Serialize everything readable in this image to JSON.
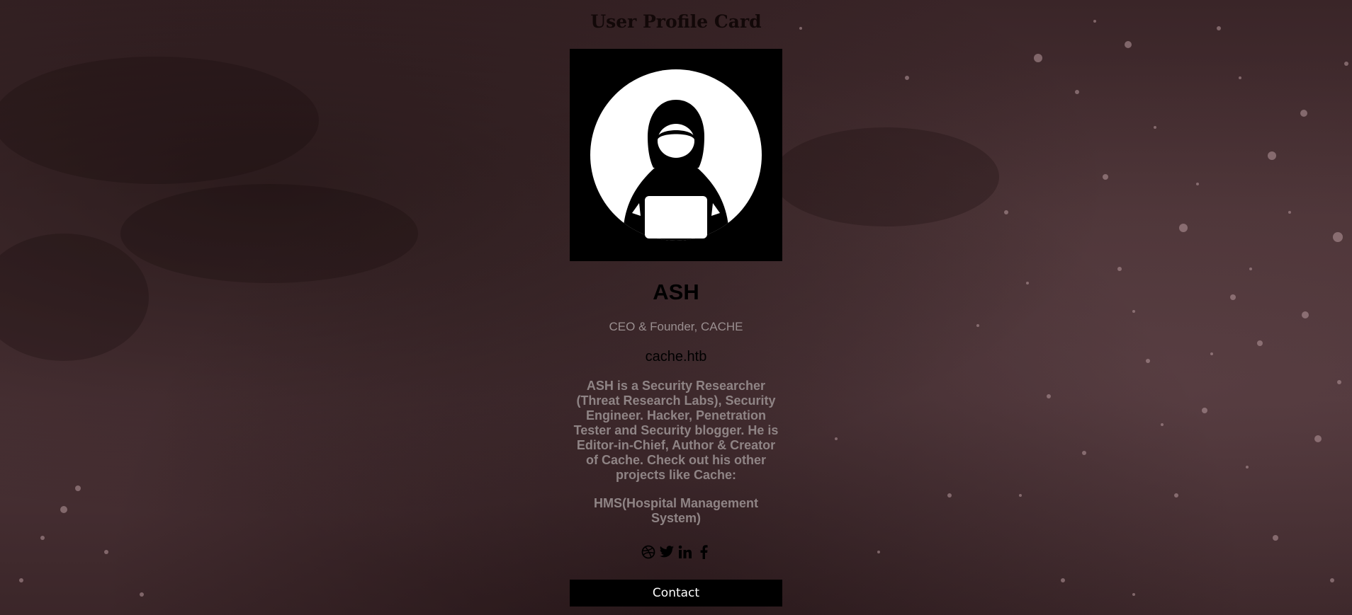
{
  "page": {
    "heading": "User Profile Card"
  },
  "profile": {
    "name": "ASH",
    "title": "CEO & Founder, CACHE",
    "website": "cache.htb",
    "bio": "ASH is a Security Researcher (Threat Research Labs), Security Engineer. Hacker, Penetration Tester and Security blogger. He is Editor-in-Chief, Author & Creator of Cache. Check out his other projects like Cache:",
    "project": "HMS(Hospital Management System)",
    "avatar_icon": "hooded-hacker-icon"
  },
  "socials": [
    {
      "icon": "dribbble-icon"
    },
    {
      "icon": "twitter-icon"
    },
    {
      "icon": "linkedin-icon"
    },
    {
      "icon": "facebook-icon"
    }
  ],
  "contact": {
    "label": "Contact"
  },
  "colors": {
    "background": "#4a3235",
    "card_dark": "#000000",
    "muted_text": "#8f8485",
    "button_text": "#ffffff"
  }
}
